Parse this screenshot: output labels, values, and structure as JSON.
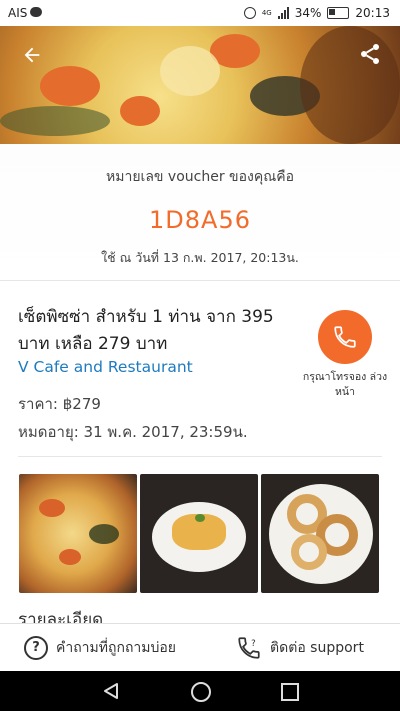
{
  "status_bar": {
    "carrier": "AIS",
    "network": "4G",
    "battery": "34%",
    "time": "20:13"
  },
  "voucher": {
    "label": "หมายเลข voucher ของคุณคือ",
    "code": "1D8A56",
    "used_at": "ใช้ ณ วันที่ 13 ก.พ. 2017, 20:13น."
  },
  "deal": {
    "title": "เซ็ตพิซซ่า สำหรับ 1 ท่าน จาก 395 บาท เหลือ 279 บาท",
    "merchant": "V Cafe and Restaurant",
    "price": "ราคา: ฿279",
    "expiry": "หมดอายุ: 31 พ.ค. 2017, 23:59น.",
    "call_label": "กรุณาโทรจอง ล่วงหน้า"
  },
  "details_heading": "รายละเอียด",
  "bottom_bar": {
    "faq_label": "คำถามที่ถูกถามบ่อย",
    "support_label": "ติดต่อ support"
  },
  "colors": {
    "accent": "#f26b2a",
    "link": "#1e7bbf"
  },
  "icons": {
    "back": "arrow-left-icon",
    "share": "share-icon",
    "call": "phone-icon",
    "faq": "question-circle-icon",
    "support": "support-phone-icon"
  }
}
